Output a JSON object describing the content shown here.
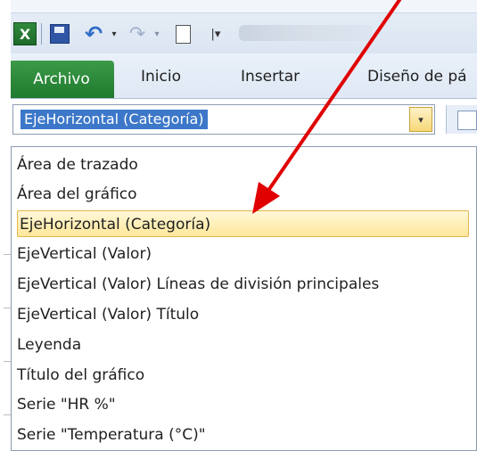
{
  "toolbar": {
    "excel_icon": "excel-app-icon",
    "excel_letter": "X",
    "undo_glyph": "↶",
    "redo_glyph": "↷",
    "dropdown_glyph": "▾",
    "customize_glyph": "|▾"
  },
  "ribbon": {
    "tabs": [
      "Archivo",
      "Inicio",
      "Insertar",
      "Diseño de pá"
    ]
  },
  "chart_elements_combo": {
    "value": "EjeHorizontal (Categoría)",
    "arrow_glyph": "▾"
  },
  "dropdown": {
    "selected_index": 2,
    "items": [
      "Área de trazado",
      "Área del gráfico",
      "EjeHorizontal (Categoría)",
      "EjeVertical (Valor)",
      "EjeVertical (Valor)  Líneas de división principales",
      "EjeVertical (Valor)  Título",
      "Leyenda",
      "Título del gráfico",
      "Serie \"HR %\"",
      "Serie \"Temperatura (°C)\""
    ]
  },
  "colors": {
    "file_tab": "#2a8a37",
    "selection_highlight": "#ffe79a",
    "combo_selection": "#3c77c9",
    "annotation_arrow": "#e00000"
  }
}
